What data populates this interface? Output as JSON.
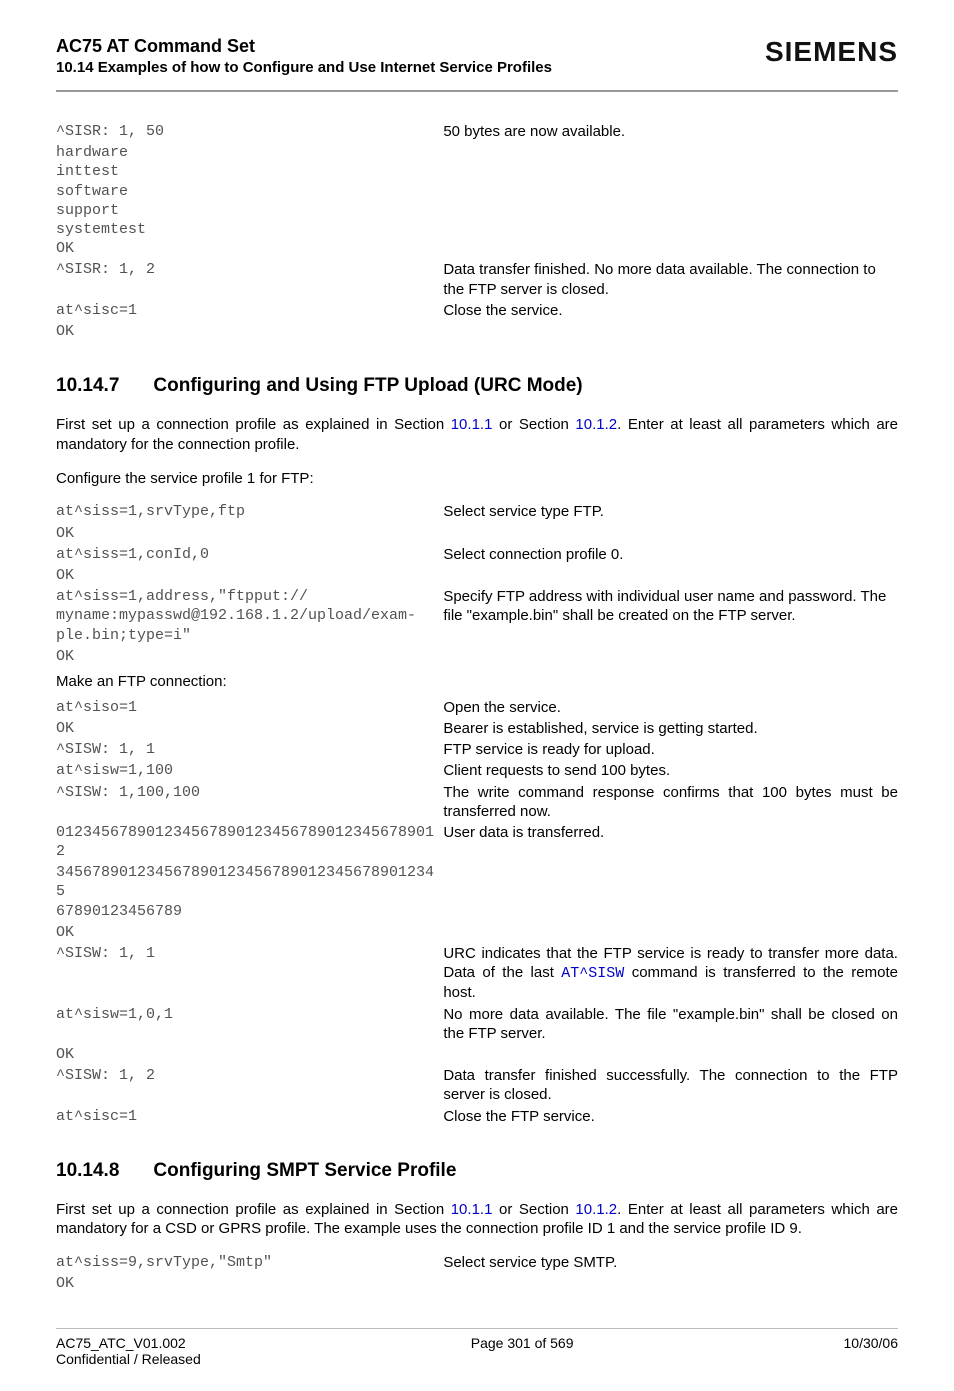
{
  "header": {
    "title": "AC75 AT Command Set",
    "subtitle": "10.14 Examples of how to Configure and Use Internet Service Profiles",
    "brand": "SIEMENS"
  },
  "block1": {
    "l1": "^SISR: 1, 50",
    "r1": "50 bytes are now available.",
    "l2": "hardware\ninttest\nsoftware\nsupport\nsystemtest\nOK",
    "l3": "^SISR: 1, 2",
    "r3": "Data transfer finished. No more data available. The connection to the FTP server is closed.",
    "l4": "at^sisc=1",
    "r4": "Close the service.",
    "l5": "OK"
  },
  "sec1": {
    "num": "10.14.7",
    "title": "Configuring and Using FTP Upload (URC Mode)"
  },
  "para1": {
    "p1a": "First set up a connection profile as explained in Section ",
    "link1": "10.1.1",
    "p1b": " or Section ",
    "link2": "10.1.2",
    "p1c": ". Enter at least all parameters which are mandatory for the connection profile.",
    "p2": "Configure the service profile 1 for FTP:"
  },
  "block2": {
    "l1": "at^siss=1,srvType,ftp",
    "r1": "Select service type FTP.",
    "l2": "OK",
    "l3": "at^siss=1,conId,0",
    "r3": "Select connection profile 0.",
    "l4": "OK",
    "l5": "at^siss=1,address,\"ftpput://\nmyname:mypasswd@192.168.1.2/upload/exam-\nple.bin;type=i\"",
    "r5": "Specify FTP address with individual user name and password. The file \"example.bin\" shall be created on the FTP server.",
    "l6": "OK"
  },
  "para2": {
    "p1": "Make an FTP connection:"
  },
  "block3": {
    "l1": "at^siso=1",
    "r1": "Open the service.",
    "l2": "OK",
    "r2": "Bearer is established, service is getting started.",
    "l3": "^SISW: 1, 1",
    "r3": "FTP service is ready for upload.",
    "l4": "at^sisw=1,100",
    "r4": "Client requests to send 100 bytes.",
    "l5": "^SISW: 1,100,100",
    "r5": "The write command response confirms that 100 bytes must be transferred now.",
    "l6": "0123456789012345678901234567890123456789012",
    "r6": "User data is transferred.",
    "l7": "3456789012345678901234567890123456789012345\n67890123456789",
    "l8": "OK",
    "l9": "^SISW: 1, 1",
    "r9a": "URC indicates that the FTP service is ready to transfer more data. Data of the last ",
    "r9code": "AT^SISW",
    "r9b": " command is transferred to the remote host.",
    "l10": "at^sisw=1,0,1",
    "r10": "No more data available. The file \"example.bin\" shall be closed on the FTP server.",
    "l11": "OK",
    "l12": "^SISW: 1, 2",
    "r12": "Data transfer finished successfully. The connection to the FTP server is closed.",
    "l13": "at^sisc=1",
    "r13": "Close the FTP service."
  },
  "sec2": {
    "num": "10.14.8",
    "title": "Configuring SMPT Service Profile"
  },
  "para3": {
    "p1a": "First set up a connection profile as explained in Section ",
    "link1": "10.1.1",
    "p1b": " or Section ",
    "link2": "10.1.2",
    "p1c": ". Enter at least all parameters which are mandatory for a CSD or GPRS profile. The example uses the connection profile ID 1 and the service profile ID 9."
  },
  "block4": {
    "l1": "at^siss=9,srvType,\"Smtp\"",
    "r1": "Select service type SMTP.",
    "l2": "OK"
  },
  "footer": {
    "left1": "AC75_ATC_V01.002",
    "left2": "Confidential / Released",
    "center": "Page 301 of 569",
    "right": "10/30/06"
  }
}
